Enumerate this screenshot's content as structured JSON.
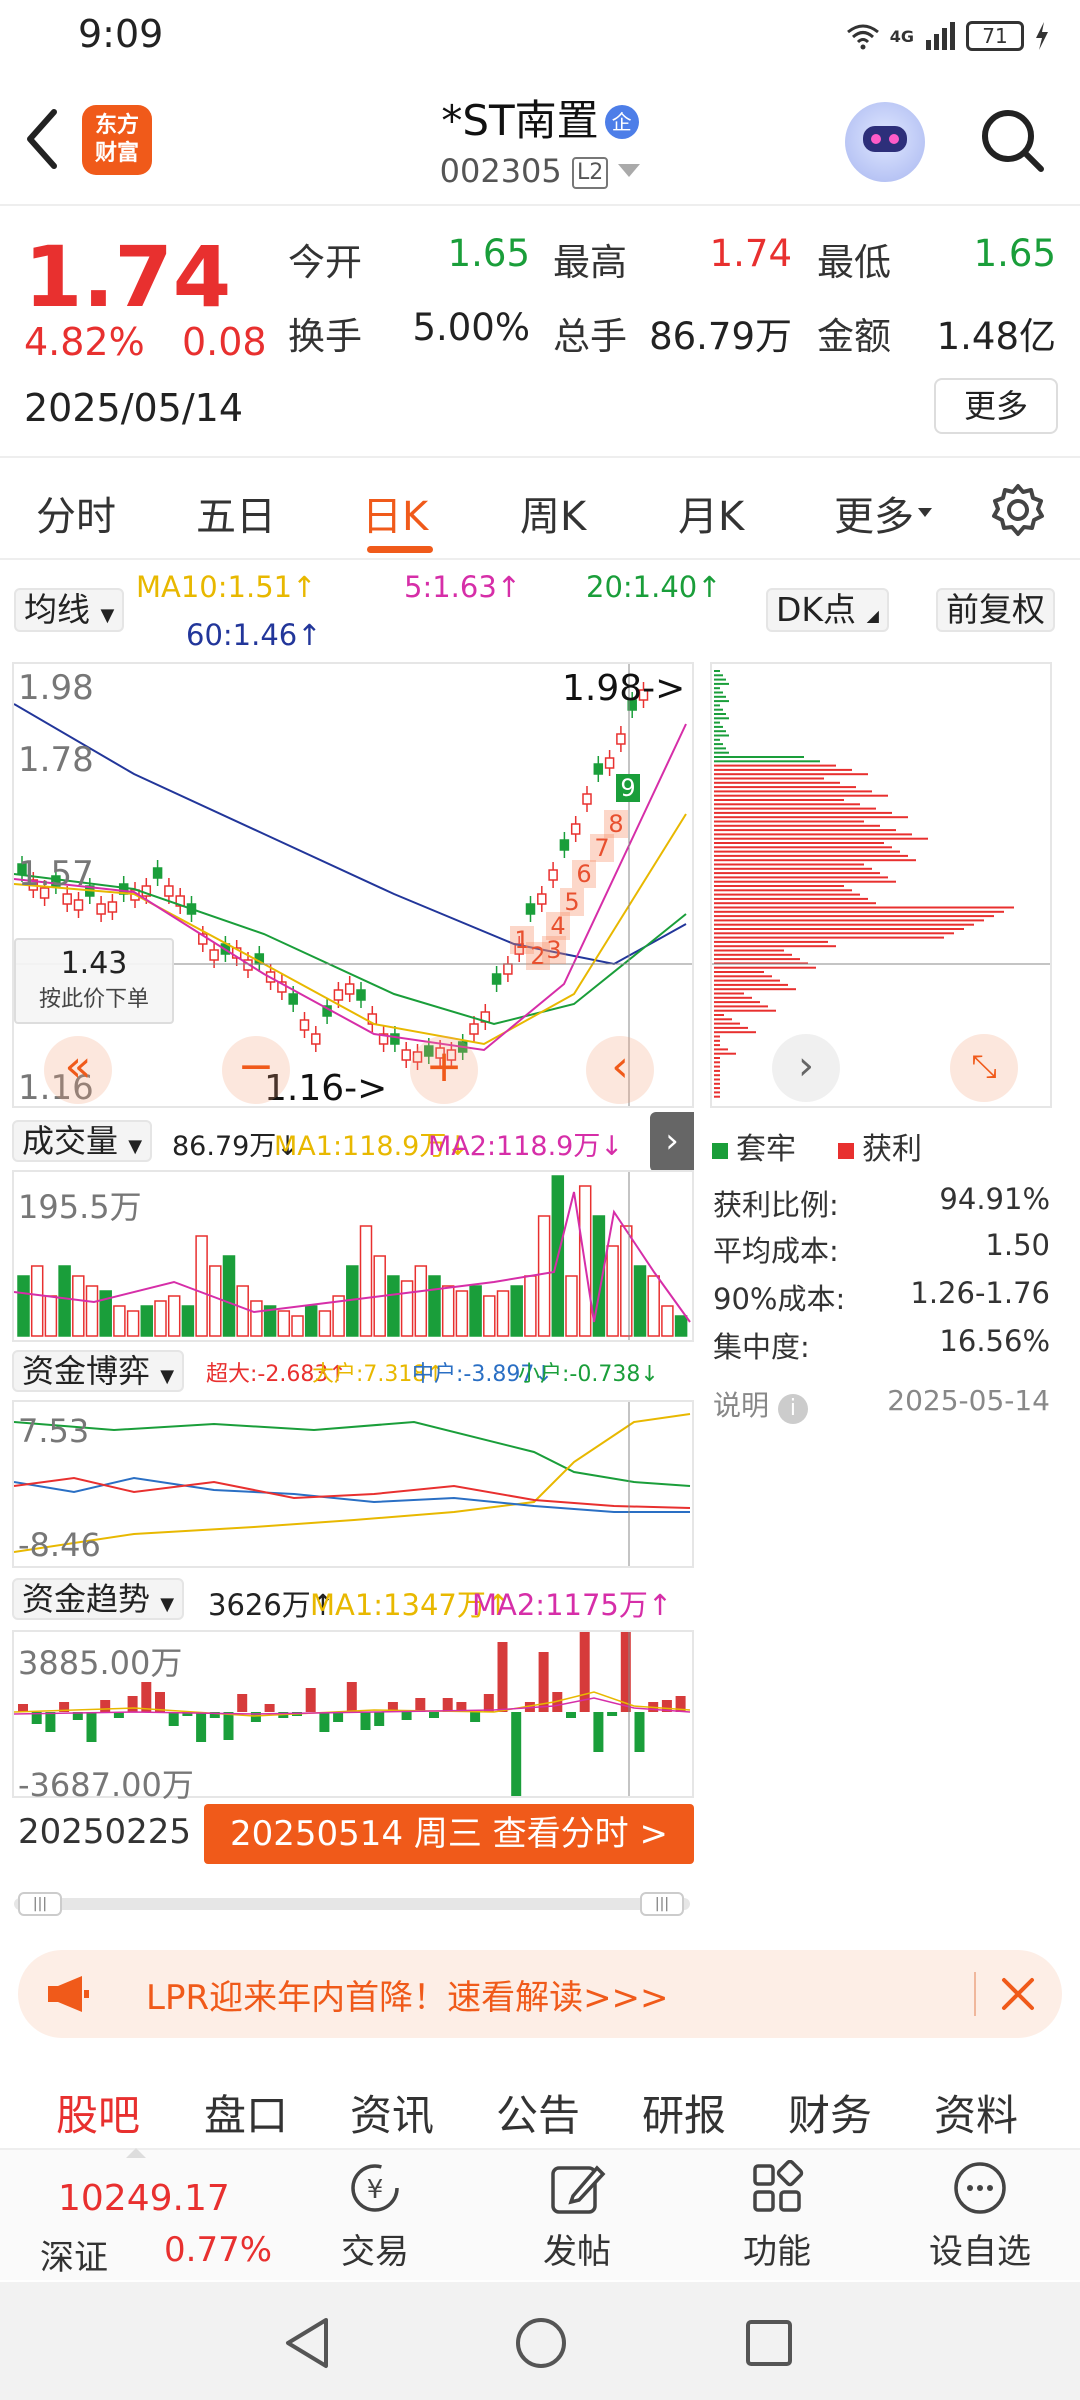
{
  "status_bar": {
    "time": "9:09",
    "network": "4G",
    "battery": "71"
  },
  "header": {
    "stock_name": "*ST南置",
    "name_badge": "企",
    "stock_code": "002305",
    "level_badge": "L2",
    "logo_text_1": "东方",
    "logo_text_2": "财富"
  },
  "quote": {
    "price": "1.74",
    "pct_change": "4.82%",
    "change": "0.08",
    "date": "2025/05/14",
    "open_label": "今开",
    "open": "1.65",
    "high_label": "最高",
    "high": "1.74",
    "low_label": "最低",
    "low": "1.65",
    "turnover_label": "换手",
    "turnover": "5.00%",
    "volume_label": "总手",
    "volume": "86.79万",
    "amount_label": "金额",
    "amount": "1.48亿",
    "more_label": "更多"
  },
  "tabs": [
    "分时",
    "五日",
    "日K",
    "周K",
    "月K",
    "更多"
  ],
  "active_tab": "日K",
  "ma_bar": {
    "selector": "均线",
    "ma10": "MA10:1.51↑",
    "ma5": "5:1.63↑",
    "ma20": "20:1.40↑",
    "ma60": "60:1.46↑",
    "dk": "DK点",
    "adjust": "前复权"
  },
  "kline": {
    "y_top": "1.98",
    "y_mid1": "1.78",
    "y_mid2": "1.57",
    "y_bottom": "1.16",
    "max_marker": "1.98->",
    "min_marker": "1.16->",
    "crosshair_price": "1.43",
    "crosshair_action": "按此价下单",
    "nine_turn": [
      "1",
      "2",
      "3",
      "4",
      "5",
      "6",
      "7",
      "8",
      "9"
    ]
  },
  "volume": {
    "selector": "成交量",
    "value": "86.79万↓",
    "ma1": "MA1:118.9万↓",
    "ma2": "MA2:118.9万↓",
    "y_top": "195.5万"
  },
  "fund_game": {
    "selector": "资金博弈",
    "super": "超大:-2.683↑",
    "big": "大户:7.318↑",
    "mid": "中户:-3.897↓",
    "small": "小户:-0.738↓",
    "y_top": "7.53",
    "y_bottom": "-8.46"
  },
  "fund_trend": {
    "selector": "资金趋势",
    "value": "3626万↑",
    "ma1": "MA1:1347万↑",
    "ma2": "MA2:1175万↑",
    "y_top": "3885.00万",
    "y_bottom": "-3687.00万"
  },
  "range": {
    "start_date": "20250225",
    "current": "20250514 周三 查看分时 >"
  },
  "chip_stats": {
    "legend_trapped": "套牢",
    "legend_profit": "获利",
    "rows": [
      {
        "label": "获利比例:",
        "value": "94.91%"
      },
      {
        "label": "平均成本:",
        "value": "1.50"
      },
      {
        "label": "90%成本:",
        "value": "1.26-1.76"
      },
      {
        "label": "集中度:",
        "value": "16.56%"
      }
    ],
    "note_label": "说明",
    "note_date": "2025-05-14"
  },
  "banner": {
    "text": "LPR迎来年内首降！速看解读>>>"
  },
  "bottom_tabs": [
    "股吧",
    "盘口",
    "资讯",
    "公告",
    "研报",
    "财务",
    "资料"
  ],
  "footer": {
    "index_value": "10249.17",
    "index_name": "深证",
    "index_pct": "0.77%",
    "items": [
      "交易",
      "发帖",
      "功能",
      "设自选"
    ]
  },
  "colors": {
    "up": "#e8302f",
    "down": "#1a9e3a",
    "accent": "#f05a1a"
  }
}
